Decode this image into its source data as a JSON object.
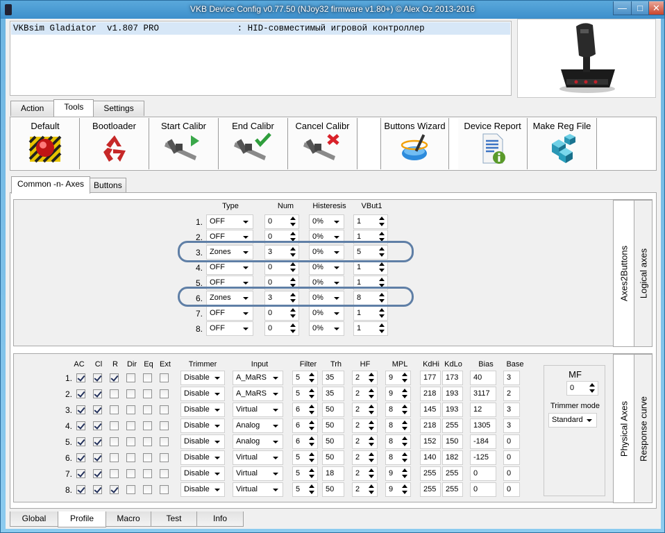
{
  "window": {
    "title": "VKB Device Config v0.77.50 (NJoy32 firmware v1.80+) © Alex Oz 2013-2016",
    "min": "—",
    "max": "□",
    "close": "✕"
  },
  "device": {
    "name": "VKBsim Gladiator  v1.807 PRO",
    "description": ": HID-совместимый игровой контроллер"
  },
  "top_tabs": [
    {
      "label": "Action"
    },
    {
      "label": "Tools",
      "active": true
    },
    {
      "label": "Settings"
    }
  ],
  "tools": [
    {
      "label": "Default",
      "icon": "red-button-icon"
    },
    {
      "label": "Bootloader",
      "icon": "recycle-icon"
    },
    {
      "label": "Start Calibr",
      "icon": "caliper-play-icon"
    },
    {
      "label": "End Calibr",
      "icon": "caliper-check-icon"
    },
    {
      "label": "Cancel Calibr",
      "icon": "caliper-cross-icon"
    },
    {
      "label": "Buttons Wizard",
      "icon": "wizard-wand-icon"
    },
    {
      "label": "Device Report",
      "icon": "report-info-icon"
    },
    {
      "label": "Make Reg File",
      "icon": "registry-cubes-icon"
    }
  ],
  "sub_tabs": [
    {
      "label": "Common -n- Axes",
      "active": true
    },
    {
      "label": "Buttons"
    }
  ],
  "axes2buttons": {
    "headers": {
      "type": "Type",
      "num": "Num",
      "hist": "Histeresis",
      "vbut": "VBut1"
    },
    "side_tabs": [
      "Axes2Buttons",
      "Logical axes"
    ],
    "rows": [
      {
        "n": "1.",
        "type": "OFF",
        "num": "0",
        "hist": "0%",
        "vbut": "1"
      },
      {
        "n": "2.",
        "type": "OFF",
        "num": "0",
        "hist": "0%",
        "vbut": "1"
      },
      {
        "n": "3.",
        "type": "Zones",
        "num": "3",
        "hist": "0%",
        "vbut": "5"
      },
      {
        "n": "4.",
        "type": "OFF",
        "num": "0",
        "hist": "0%",
        "vbut": "1"
      },
      {
        "n": "5.",
        "type": "OFF",
        "num": "0",
        "hist": "0%",
        "vbut": "1"
      },
      {
        "n": "6.",
        "type": "Zones",
        "num": "3",
        "hist": "0%",
        "vbut": "8"
      },
      {
        "n": "7.",
        "type": "OFF",
        "num": "0",
        "hist": "0%",
        "vbut": "1"
      },
      {
        "n": "8.",
        "type": "OFF",
        "num": "0",
        "hist": "0%",
        "vbut": "1"
      }
    ]
  },
  "physical": {
    "headers": {
      "ac": "AC",
      "cl": "Cl",
      "r": "R",
      "dir": "Dir",
      "eq": "Eq",
      "ext": "Ext",
      "trimmer": "Trimmer",
      "input": "Input",
      "filter": "Filter",
      "trh": "Trh",
      "hf": "HF",
      "mpl": "MPL",
      "kdhi": "KdHi",
      "kdlo": "KdLo",
      "bias": "Bias",
      "base": "Base"
    },
    "side_tabs": [
      "Physical Axes",
      "Response curve"
    ],
    "rows": [
      {
        "n": "1.",
        "ac": true,
        "cl": true,
        "r": true,
        "dir": false,
        "eq": false,
        "ext": false,
        "trimmer": "Disable",
        "input": "A_MaRS",
        "filter": "5",
        "trh": "35",
        "hf": "2",
        "mpl": "9",
        "kdhi": "177",
        "kdlo": "173",
        "bias": "40",
        "base": "3"
      },
      {
        "n": "2.",
        "ac": true,
        "cl": true,
        "r": false,
        "dir": false,
        "eq": false,
        "ext": false,
        "trimmer": "Disable",
        "input": "A_MaRS",
        "filter": "5",
        "trh": "35",
        "hf": "2",
        "mpl": "9",
        "kdhi": "218",
        "kdlo": "193",
        "bias": "3117",
        "base": "2"
      },
      {
        "n": "3.",
        "ac": true,
        "cl": true,
        "r": false,
        "dir": false,
        "eq": false,
        "ext": false,
        "trimmer": "Disable",
        "input": "Virtual",
        "filter": "6",
        "trh": "50",
        "hf": "2",
        "mpl": "8",
        "kdhi": "145",
        "kdlo": "193",
        "bias": "12",
        "base": "3"
      },
      {
        "n": "4.",
        "ac": true,
        "cl": true,
        "r": false,
        "dir": false,
        "eq": false,
        "ext": false,
        "trimmer": "Disable",
        "input": "Analog",
        "filter": "6",
        "trh": "50",
        "hf": "2",
        "mpl": "8",
        "kdhi": "218",
        "kdlo": "255",
        "bias": "1305",
        "base": "3"
      },
      {
        "n": "5.",
        "ac": true,
        "cl": true,
        "r": false,
        "dir": false,
        "eq": false,
        "ext": false,
        "trimmer": "Disable",
        "input": "Analog",
        "filter": "6",
        "trh": "50",
        "hf": "2",
        "mpl": "8",
        "kdhi": "152",
        "kdlo": "150",
        "bias": "-184",
        "base": "0"
      },
      {
        "n": "6.",
        "ac": true,
        "cl": true,
        "r": false,
        "dir": false,
        "eq": false,
        "ext": false,
        "trimmer": "Disable",
        "input": "Virtual",
        "filter": "5",
        "trh": "50",
        "hf": "2",
        "mpl": "8",
        "kdhi": "140",
        "kdlo": "182",
        "bias": "-125",
        "base": "0"
      },
      {
        "n": "7.",
        "ac": true,
        "cl": true,
        "r": false,
        "dir": false,
        "eq": false,
        "ext": false,
        "trimmer": "Disable",
        "input": "Virtual",
        "filter": "5",
        "trh": "18",
        "hf": "2",
        "mpl": "9",
        "kdhi": "255",
        "kdlo": "255",
        "bias": "0",
        "base": "0"
      },
      {
        "n": "8.",
        "ac": true,
        "cl": true,
        "r": true,
        "dir": false,
        "eq": false,
        "ext": false,
        "trimmer": "Disable",
        "input": "Virtual",
        "filter": "5",
        "trh": "50",
        "hf": "2",
        "mpl": "9",
        "kdhi": "255",
        "kdlo": "255",
        "bias": "0",
        "base": "0"
      }
    ],
    "mf": {
      "label": "MF",
      "value": "0",
      "trimmer_mode_label": "Trimmer mode",
      "trimmer_mode": "Standard"
    }
  },
  "bottom_tabs": [
    {
      "label": "Global"
    },
    {
      "label": "Profile",
      "active": true
    },
    {
      "label": "Macro"
    },
    {
      "label": "Test"
    },
    {
      "label": "Info"
    }
  ]
}
